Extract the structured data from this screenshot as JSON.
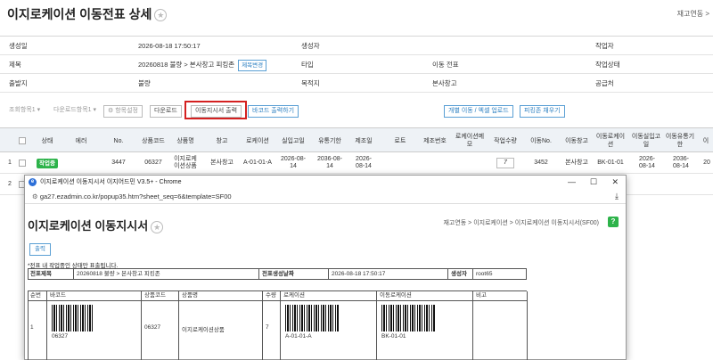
{
  "header": {
    "title": "이지로케이션 이동전표 상세",
    "breadcrumb": "재고연동 >"
  },
  "info": {
    "row1": {
      "l1": "생성일",
      "v1": "2026-08-18 17:50:17",
      "l2": "생성자",
      "l3": "작업자"
    },
    "row2": {
      "l1": "제목",
      "v1": "20260818 불량 > 본사창고 피킹존",
      "tag": "제목변경",
      "l2": "타입",
      "v2": "이동 전표",
      "l3": "작업상태"
    },
    "row3": {
      "l1": "출발지",
      "v1": "불량",
      "l2": "목적지",
      "v2": "본사창고",
      "l3": "공급처"
    }
  },
  "toolbar": {
    "sel1": "조회항목1 ▾",
    "sel2": "다운로드항목1 ▾",
    "settings": "⚙ 항목설정",
    "download": "다운로드",
    "print_move": "이동지시서 출력",
    "print_barcode": "바코드 출력하기",
    "upload": "개별 이동 / 엑셀 업로드",
    "fill_picking": "피킹존 채우기"
  },
  "grid": {
    "columns": [
      "상태",
      "에러",
      "No.",
      "상품코드",
      "상품명",
      "창고",
      "로케이션",
      "실입고일",
      "유통기한",
      "제조일",
      "로트",
      "제조번호",
      "로케이션메모",
      "작업수량",
      "이동No.",
      "이동창고",
      "이동로케이션",
      "이동실입고일",
      "이동유통기한",
      "이"
    ],
    "rows": [
      {
        "idx": "1",
        "status": "작업중",
        "no": "3447",
        "code": "06327",
        "name": "이지로케이션상품",
        "wh": "본사창고",
        "loc": "A-01-01-A",
        "in": "2026-08-14",
        "exp": "2036-08-14",
        "mfg": "2026-08-14",
        "qty": "7",
        "mno": "3452",
        "mwh": "본사창고",
        "mloc": "BK-01-01",
        "min": "2026-08-14",
        "mexp": "2036-08-14",
        "last": "20"
      },
      {
        "idx": "2"
      }
    ]
  },
  "popup": {
    "window_title": "이지로케이션 이동지시서 이지어드민 V3.5+ - Chrome",
    "url": "ga27.ezadmin.co.kr/popup35.htm?sheet_seq=6&template=SF00",
    "heading": "이지로케이션 이동지시서",
    "breadcrumb": "재고연동 > 이지로케이션 > 이지로케이션 이동지시서(SF00)",
    "print": "출력",
    "note": "*전표 내 작업중인 상태만 표출됩니다.",
    "summary": {
      "l_title": "전표제목",
      "title": "20260818 불량 > 본사창고 피킹존",
      "l_date": "전표생성날짜",
      "date": "2026-08-18 17:50:17",
      "l_user": "생성자",
      "user": "root65"
    },
    "table": {
      "headers": [
        "순번",
        "바코드",
        "상품코드",
        "상품명",
        "수량",
        "로케이션",
        "이동로케이션",
        "비고"
      ],
      "row": {
        "seq": "1",
        "barcode_text": "06327",
        "code": "06327",
        "name": "이지로케이션상품",
        "qty": "7",
        "loc": "A-01-01-A",
        "mloc": "BK-01-01"
      }
    }
  }
}
